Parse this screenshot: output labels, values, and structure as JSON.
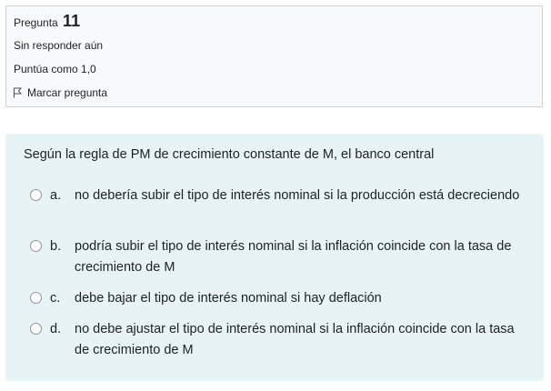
{
  "question_info": {
    "title_prefix": "Pregunta",
    "number": "11",
    "state": "Sin responder aún",
    "grade": "Puntúa como 1,0",
    "flag_label": "Marcar pregunta"
  },
  "question": {
    "text": "Según la regla de PM de crecimiento constante de M, el banco central",
    "answers": [
      {
        "letter": "a.",
        "text": "no debería subir el tipo de interés nominal si la producción está decreciendo"
      },
      {
        "letter": "b.",
        "text": "podría subir el tipo de interés nominal si la inflación coincide con la tasa de crecimiento de M"
      },
      {
        "letter": "c.",
        "text": "debe bajar el tipo de interés nominal si hay deflación"
      },
      {
        "letter": "d.",
        "text": "no debe ajustar el tipo de interés nominal si la inflación coincide con la tasa de crecimiento de M"
      }
    ]
  },
  "colors": {
    "info_bg": "#f8f9fa",
    "content_bg": "#e7f3f5",
    "text": "#1d2125"
  }
}
